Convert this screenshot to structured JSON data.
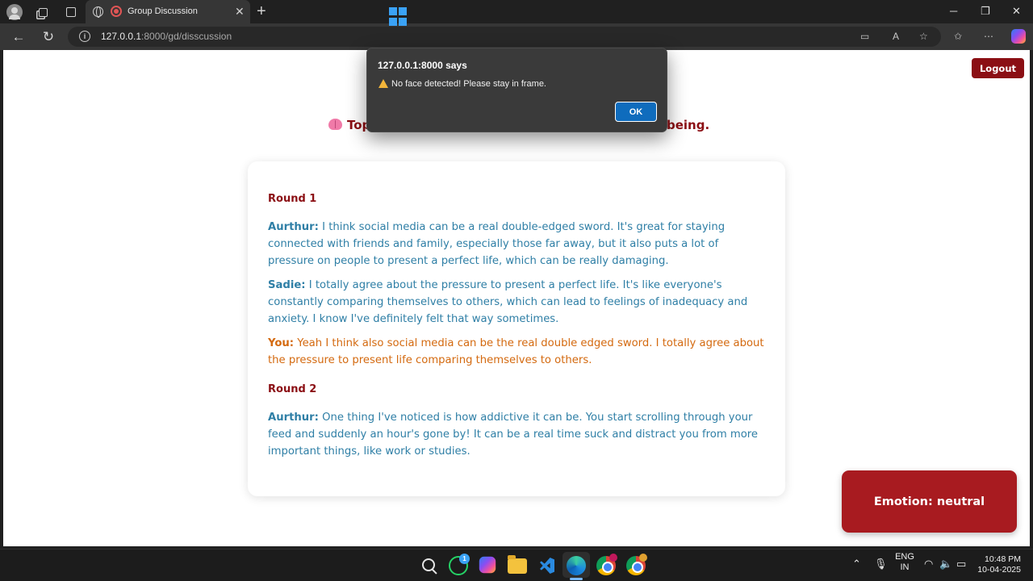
{
  "browser": {
    "tab_title": "Group Discussion",
    "url_host": "127.0.0.1",
    "url_rest": ":8000/gd/disscussion"
  },
  "page": {
    "logout_label": "Logout",
    "topic_start": "Top",
    "topic_end": "being.",
    "rounds": [
      {
        "label": "Round 1",
        "messages": [
          {
            "speaker": "Aurthur:",
            "text": "I think social media can be a real double-edged sword. It's great for staying connected with friends and family, especially those far away, but it also puts a lot of pressure on people to present a perfect life, which can be really damaging."
          },
          {
            "speaker": "Sadie:",
            "text": "I totally agree about the pressure to present a perfect life. It's like everyone's constantly comparing themselves to others, which can lead to feelings of inadequacy and anxiety. I know I've definitely felt that way sometimes."
          },
          {
            "speaker": "You:",
            "text": "Yeah I think also social media can be the real double edged sword. I totally agree about the pressure to present life comparing themselves to others."
          }
        ]
      },
      {
        "label": "Round 2",
        "messages": [
          {
            "speaker": "Aurthur:",
            "text": "One thing I've noticed is how addictive it can be. You start scrolling through your feed and suddenly an hour's gone by! It can be a real time suck and distract you from more important things, like work or studies."
          }
        ]
      }
    ],
    "emotion_label": "Emotion: neutral"
  },
  "dialog": {
    "title": "127.0.0.1:8000 says",
    "message": "No face detected! Please stay in frame.",
    "ok_label": "OK"
  },
  "taskbar": {
    "whatsapp_badge": "1",
    "lang_top": "ENG",
    "lang_bottom": "IN",
    "time": "10:48 PM",
    "date": "10-04-2025"
  },
  "colors": {
    "accent_dark_red": "#8b0f14",
    "emotion_red": "#a81b20",
    "other_speaker": "#2f7fa6",
    "you_speaker": "#d46a10",
    "ok_blue": "#0f6cbd"
  }
}
